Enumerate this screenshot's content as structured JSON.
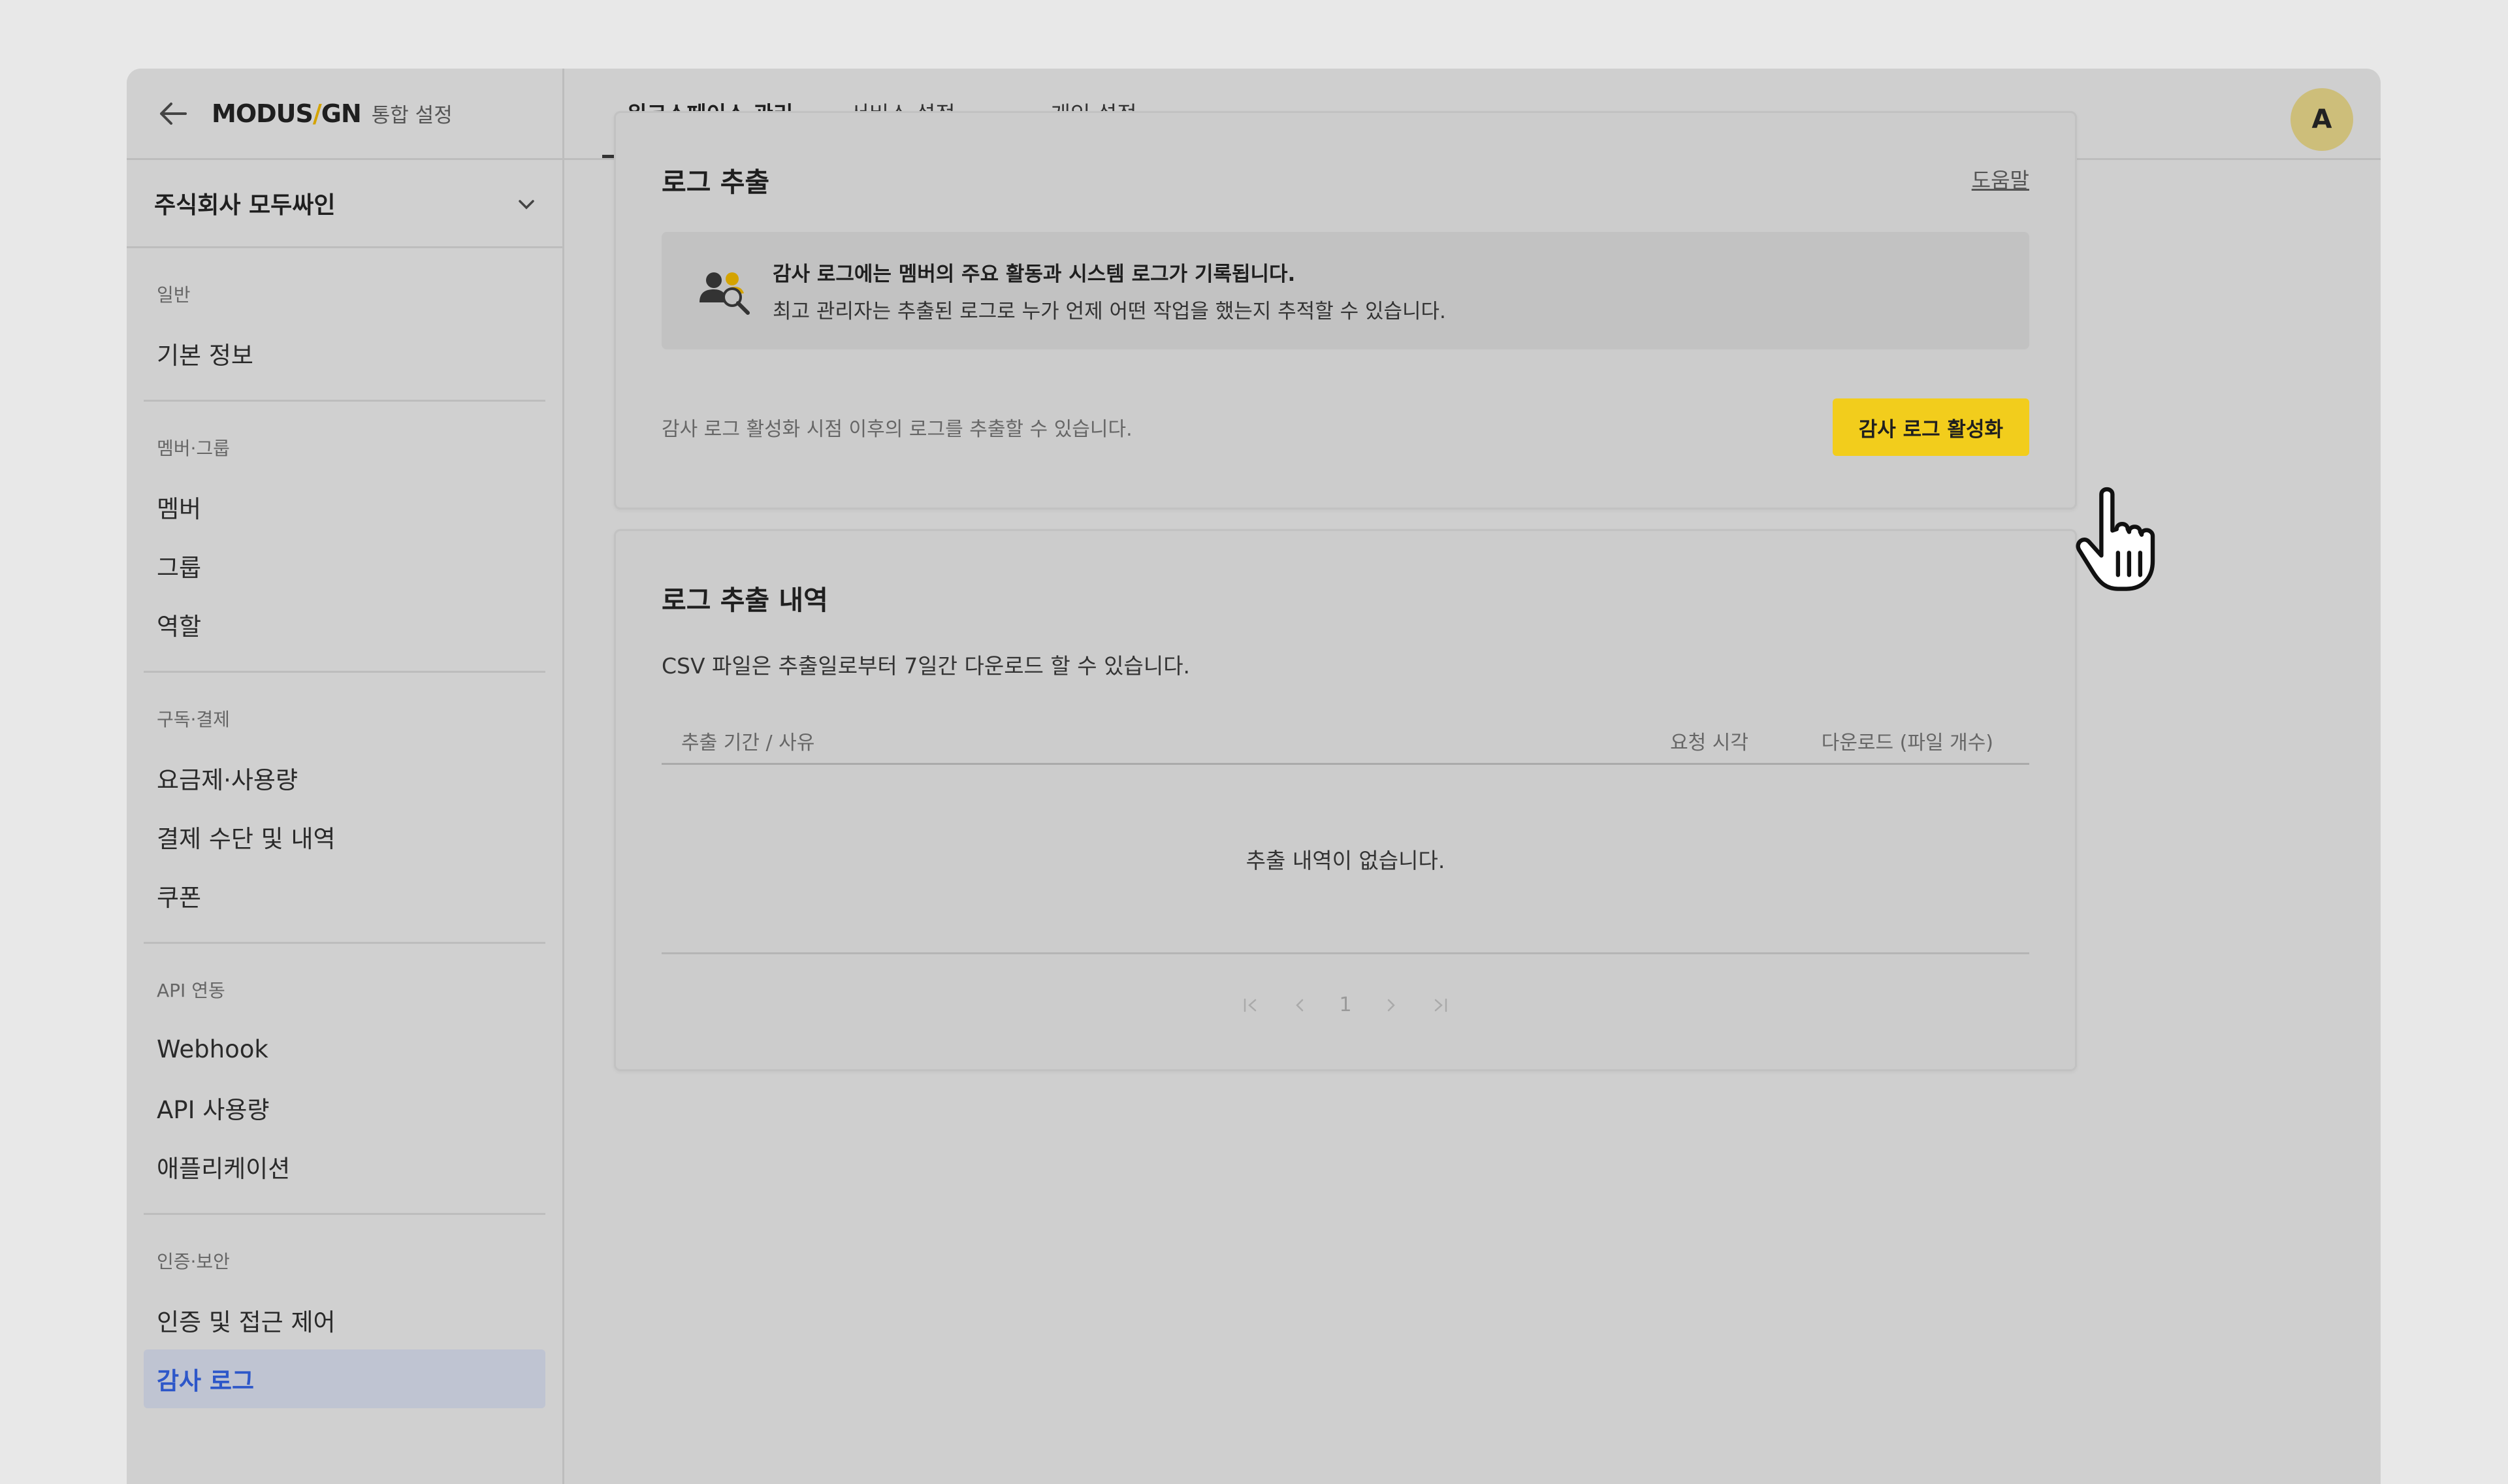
{
  "header": {
    "logo_main": "MODUS",
    "logo_slash": "/",
    "logo_tail": "GN",
    "logo_sub": "통합 설정"
  },
  "org_name": "주식회사 모두싸인",
  "sidebar": {
    "sections": [
      {
        "title": "일반",
        "items": [
          "기본 정보"
        ]
      },
      {
        "title": "멤버·그룹",
        "items": [
          "멤버",
          "그룹",
          "역할"
        ]
      },
      {
        "title": "구독·결제",
        "items": [
          "요금제·사용량",
          "결제 수단 및 내역",
          "쿠폰"
        ]
      },
      {
        "title": "API 연동",
        "items": [
          "Webhook",
          "API 사용량",
          "애플리케이션"
        ]
      },
      {
        "title": "인증·보안",
        "items": [
          "인증 및 접근 제어",
          "감사 로그"
        ]
      }
    ],
    "active_item": "감사 로그"
  },
  "tabs": {
    "t1": "워크스페이스 관리",
    "t2": "서비스 설정",
    "t3": "개인 설정"
  },
  "avatar_letter": "A",
  "log_export": {
    "title": "로그 추출",
    "help": "도움말",
    "info_line1": "감사 로그에는 멤버의 주요 활동과 시스템 로그가 기록됩니다.",
    "info_line2": "최고 관리자는 추출된 로그로 누가 언제 어떤 작업을 했는지 추적할 수 있습니다.",
    "note": "감사 로그 활성화 시점 이후의 로그를 추출할 수 있습니다.",
    "activate_button": "감사 로그 활성화"
  },
  "history": {
    "title": "로그 추출 내역",
    "csv_note": "CSV 파일은 추출일로부터 7일간 다운로드 할 수 있습니다.",
    "columns": [
      "추출 기간 / 사유",
      "요청 시각",
      "다운로드 (파일 개수)"
    ],
    "empty": "추출 내역이 없습니다.",
    "page": "1"
  },
  "colors": {
    "accent": "#f2cd1c",
    "active_nav": "#2d57c9",
    "logo_slash": "#d4a300"
  }
}
